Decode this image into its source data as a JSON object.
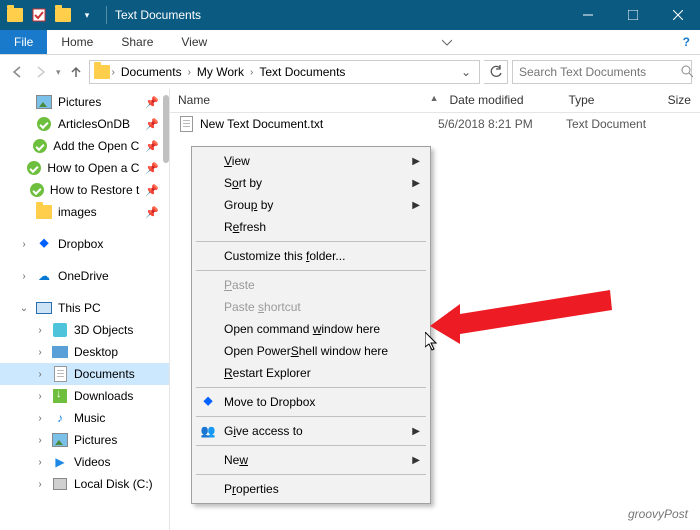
{
  "title": "Text Documents",
  "ribbon": {
    "file": "File",
    "tabs": [
      "Home",
      "Share",
      "View"
    ]
  },
  "breadcrumb": [
    "Documents",
    "My Work",
    "Text Documents"
  ],
  "search": {
    "placeholder": "Search Text Documents"
  },
  "nav": {
    "quick": [
      {
        "label": "Pictures",
        "pinned": true,
        "icon": "pic"
      },
      {
        "label": "ArticlesOnDB",
        "pinned": true,
        "icon": "green"
      },
      {
        "label": "Add the Open C",
        "pinned": true,
        "icon": "green"
      },
      {
        "label": "How to Open a C",
        "pinned": true,
        "icon": "green"
      },
      {
        "label": "How to Restore t",
        "pinned": true,
        "icon": "green"
      },
      {
        "label": "images",
        "pinned": true,
        "icon": "folder"
      }
    ],
    "dropbox": "Dropbox",
    "onedrive": "OneDrive",
    "thispc": "This PC",
    "pcitems": [
      {
        "label": "3D Objects",
        "icon": "3d"
      },
      {
        "label": "Desktop",
        "icon": "desk"
      },
      {
        "label": "Documents",
        "icon": "doc",
        "selected": true
      },
      {
        "label": "Downloads",
        "icon": "dl"
      },
      {
        "label": "Music",
        "icon": "music"
      },
      {
        "label": "Pictures",
        "icon": "pic"
      },
      {
        "label": "Videos",
        "icon": "vid"
      },
      {
        "label": "Local Disk (C:)",
        "icon": "disk"
      }
    ]
  },
  "columns": {
    "name": "Name",
    "date": "Date modified",
    "type": "Type",
    "size": "Size"
  },
  "files": [
    {
      "name": "New Text Document.txt",
      "date": "5/6/2018 8:21 PM",
      "type": "Text Document"
    }
  ],
  "ctx": {
    "view": "View",
    "sort": "Sort by",
    "group": "Group by",
    "refresh": "Refresh",
    "customize": "Customize this folder...",
    "paste": "Paste",
    "paste_shortcut": "Paste shortcut",
    "open_cmd": "Open command window here",
    "open_ps": "Open PowerShell window here",
    "restart": "Restart Explorer",
    "dropbox": "Move to Dropbox",
    "give": "Give access to",
    "new": "New",
    "properties": "Properties"
  },
  "watermark": "groovyPost"
}
